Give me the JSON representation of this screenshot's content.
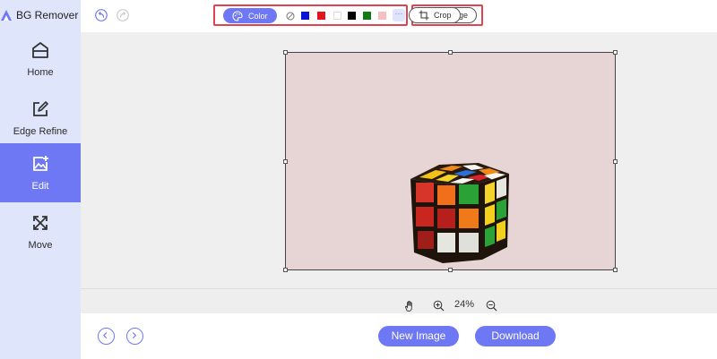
{
  "app": {
    "title": "BG Remover"
  },
  "sidebar": {
    "items": [
      {
        "label": "Home",
        "icon": "home-icon"
      },
      {
        "label": "Edge Refine",
        "icon": "edit-square-icon"
      },
      {
        "label": "Edit",
        "icon": "image-edit-icon",
        "active": true
      },
      {
        "label": "Move",
        "icon": "move-arrows-icon"
      }
    ]
  },
  "toolbar": {
    "undo_icon": "undo-icon",
    "redo_icon": "redo-icon",
    "color_label": "Color",
    "swatches": [
      "#0a14d8",
      "#e3141c",
      "#ffffff",
      "#000000",
      "#127a12",
      "#f5bfc3"
    ],
    "image_label": "Image",
    "crop_label": "Crop"
  },
  "canvas": {
    "background_color": "#e7d4d4"
  },
  "zoom": {
    "value": "24%"
  },
  "actions": {
    "new_image_label": "New Image",
    "download_label": "Download"
  },
  "colors": {
    "accent": "#6e78f5",
    "highlight": "#e0434f",
    "sidebar": "#dfe5fb"
  }
}
